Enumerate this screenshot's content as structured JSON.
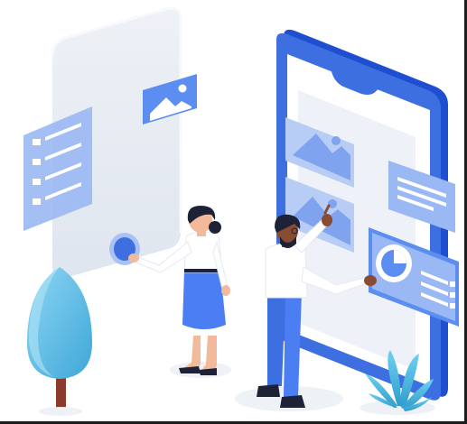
{
  "illustration": {
    "kind": "isometric mobile app design illustration",
    "colors": {
      "primary_blue": "#3d6fe0",
      "light_blue": "#8fb0f0",
      "pale_blue": "#d6e3fb",
      "phone_screen": "#eef1f7",
      "tree": "#6cc3e8",
      "trunk": "#8a3b2b",
      "plant": "#4fb6e0",
      "skin": "#f2b99a",
      "hair": "#1d2236"
    },
    "icons": [
      "image-icon",
      "list-icon",
      "toggle-icon",
      "finger-button-icon"
    ]
  }
}
